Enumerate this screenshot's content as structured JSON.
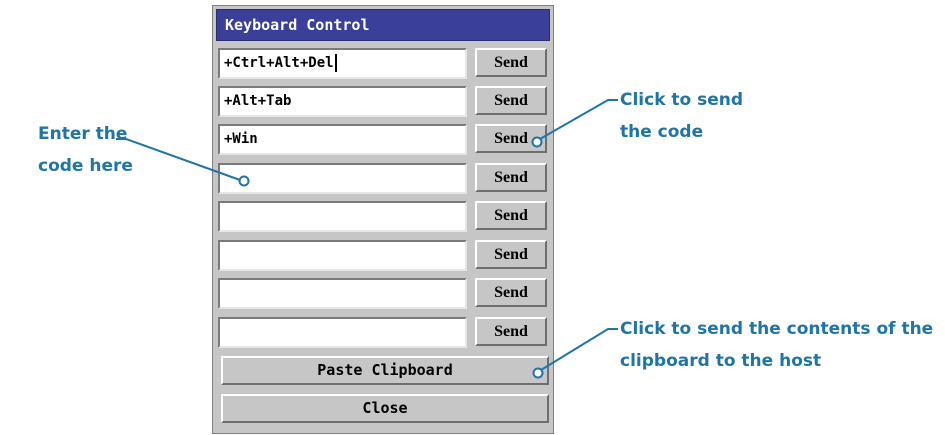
{
  "dialog": {
    "title": "Keyboard Control",
    "rows": [
      {
        "value": "+Ctrl+Alt+Del",
        "send_label": "Send"
      },
      {
        "value": "+Alt+Tab",
        "send_label": "Send"
      },
      {
        "value": "+Win",
        "send_label": "Send"
      },
      {
        "value": "",
        "send_label": "Send"
      },
      {
        "value": "",
        "send_label": "Send"
      },
      {
        "value": "",
        "send_label": "Send"
      },
      {
        "value": "",
        "send_label": "Send"
      },
      {
        "value": "",
        "send_label": "Send"
      }
    ],
    "paste_label": "Paste Clipboard",
    "close_label": "Close"
  },
  "annotations": {
    "enter_code": {
      "line1": "Enter the",
      "line2": "code here"
    },
    "click_send": {
      "line1": "Click to send",
      "line2": "the code"
    },
    "click_paste": {
      "line1": "Click to send the contents of the",
      "line2": "clipboard to the host"
    }
  },
  "colors": {
    "titlebar": "#3a3f9a",
    "panel": "#c6c6c6",
    "callout": "#1f74a8"
  }
}
